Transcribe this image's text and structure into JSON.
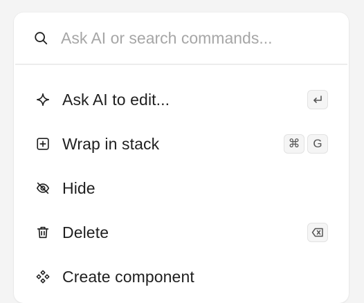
{
  "search": {
    "placeholder": "Ask AI or search commands...",
    "icon": "search-icon"
  },
  "menu": {
    "items": [
      {
        "label": "Ask AI to edit...",
        "icon": "sparkle-icon",
        "shortcut_icons": [
          "enter-key-icon"
        ]
      },
      {
        "label": "Wrap in stack",
        "icon": "plus-square-icon",
        "shortcut_keys": [
          "⌘",
          "G"
        ]
      },
      {
        "label": "Hide",
        "icon": "eye-off-icon"
      },
      {
        "label": "Delete",
        "icon": "trash-icon",
        "shortcut_icons": [
          "backspace-key-icon"
        ]
      },
      {
        "label": "Create component",
        "icon": "component-icon"
      }
    ]
  },
  "colors": {
    "background": "#f4f4f4",
    "panel": "#ffffff",
    "text": "#1f1f1f",
    "placeholder": "#a6a6a6",
    "key_bg": "#f5f5f5",
    "key_border": "#e2e2e2"
  }
}
